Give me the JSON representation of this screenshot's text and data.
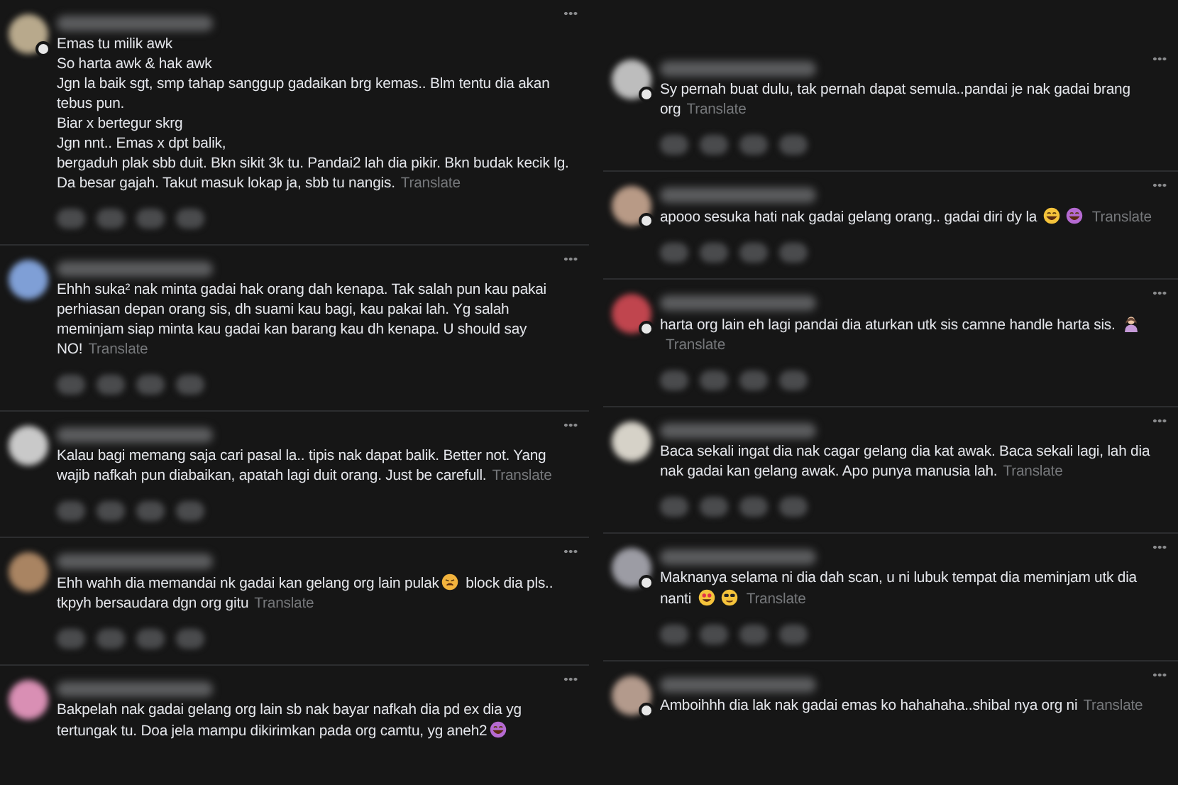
{
  "columns": [
    {
      "comments": [
        {
          "color": "#b8a98c",
          "badge": true,
          "has_reactions": true,
          "body": [
            {
              "kind": "text",
              "text": "Emas tu milik awk\nSo harta awk & hak awk\nJgn la baik sgt, smp tahap sanggup gadaikan brg kemas.. Blm tentu dia akan tebus pun.\nBiar x bertegur skrg\nJgn nnt.. Emas x dpt balik,\nbergaduh plak sbb duit. Bkn sikit 3k tu. Pandai2 lah dia pikir. Bkn budak kecik lg.\nDa besar gajah. Takut masuk lokap ja, sbb tu nangis."
            }
          ],
          "translate": "Translate"
        },
        {
          "color": "#7f9fd6",
          "badge": false,
          "has_reactions": true,
          "body": [
            {
              "kind": "text",
              "text": "Ehhh suka² nak minta gadai hak orang dah kenapa. Tak salah pun kau pakai perhiasan depan orang sis, dh suami kau bagi, kau pakai lah. Yg salah meminjam siap minta kau gadai kan barang kau dh kenapa. U should say NO!"
            }
          ],
          "translate": "Translate"
        },
        {
          "color": "#c9c9c9",
          "badge": false,
          "has_reactions": true,
          "body": [
            {
              "kind": "text",
              "text": "Kalau bagi memang saja cari pasal la.. tipis nak dapat balik. Better not. Yang wajib nafkah pun diabaikan, apatah lagi duit orang. Just be carefull."
            }
          ],
          "translate": "Translate"
        },
        {
          "color": "#a98462",
          "badge": false,
          "has_reactions": true,
          "body": [
            {
              "kind": "text",
              "text": "Ehh wahh dia memandai nk gadai kan gelang org lain pulak"
            },
            {
              "kind": "weary"
            },
            {
              "kind": "text",
              "text": " block dia pls.. tkpyh bersaudara dgn org gitu"
            }
          ],
          "translate": "Translate"
        },
        {
          "color": "#d98fb4",
          "badge": false,
          "has_reactions": false,
          "body": [
            {
              "kind": "text",
              "text": "Bakpelah nak gadai gelang org lain sb nak bayar nafkah dia pd ex dia yg tertungak tu. Doa jela mampu dikirimkan pada org camtu, yg aneh2"
            },
            {
              "kind": "rofl"
            }
          ]
        }
      ]
    },
    {
      "comments": [
        {
          "color": "#bdbdbd",
          "badge": true,
          "has_reactions": true,
          "body": [
            {
              "kind": "text",
              "text": "Sy pernah buat dulu, tak pernah dapat semula..pandai je nak gadai brang org"
            }
          ],
          "translate": "Translate"
        },
        {
          "color": "#b89a86",
          "badge": true,
          "has_reactions": true,
          "body": [
            {
              "kind": "text",
              "text": "apooo sesuka hati nak gadai gelang orang.. gadai diri dy la "
            },
            {
              "kind": "grin"
            },
            {
              "kind": "rofl"
            }
          ],
          "translate": "Translate"
        },
        {
          "color": "#c0454e",
          "badge": true,
          "has_reactions": true,
          "body": [
            {
              "kind": "text",
              "text": "harta org lain eh lagi pandai dia aturkan utk sis camne handle harta sis. "
            },
            {
              "kind": "person"
            }
          ],
          "translate": "Translate"
        },
        {
          "color": "#d6d2c8",
          "badge": false,
          "has_reactions": true,
          "body": [
            {
              "kind": "text",
              "text": "Baca sekali ingat dia nak cagar gelang dia kat awak. Baca sekali lagi, lah dia nak gadai kan gelang awak. Apo punya manusia lah."
            }
          ],
          "translate": "Translate"
        },
        {
          "color": "#9c9ca4",
          "badge": true,
          "has_reactions": true,
          "body": [
            {
              "kind": "text",
              "text": "Maknanya selama ni dia dah scan, u ni lubuk tempat dia meminjam utk dia nanti "
            },
            {
              "kind": "heart-eyes"
            },
            {
              "kind": "cool"
            }
          ],
          "translate": "Translate"
        },
        {
          "color": "#b39a8c",
          "badge": true,
          "has_reactions": false,
          "body": [
            {
              "kind": "text",
              "text": "Amboihhh dia lak nak gadai emas ko hahahaha..shibal nya org ni"
            }
          ],
          "translate": "Translate"
        }
      ]
    }
  ]
}
